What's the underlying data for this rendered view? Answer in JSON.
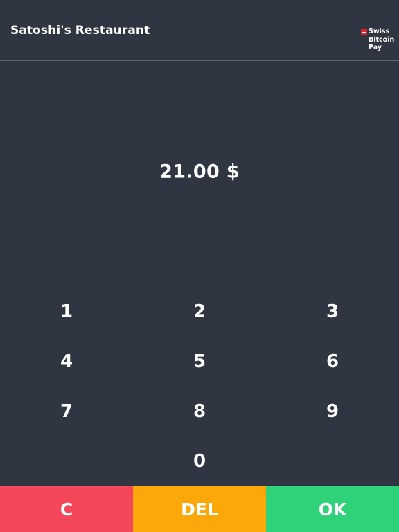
{
  "header": {
    "merchant_name": "Satoshi's Restaurant",
    "brand": {
      "line1": "Swiss",
      "line2": "Bitcoin",
      "line3": "Pay",
      "logo_icon": "swiss-flag-icon"
    }
  },
  "amount": {
    "display": "21.00 $"
  },
  "keypad": {
    "keys": [
      "1",
      "2",
      "3",
      "4",
      "5",
      "6",
      "7",
      "8",
      "9",
      "0"
    ]
  },
  "actions": {
    "clear_label": "C",
    "delete_label": "DEL",
    "ok_label": "OK"
  },
  "colors": {
    "background": "#2f3541",
    "divider": "#5f6672",
    "clear_button": "#f4485a",
    "delete_button": "#fca70a",
    "ok_button": "#2fd278",
    "text": "#ffffff"
  }
}
